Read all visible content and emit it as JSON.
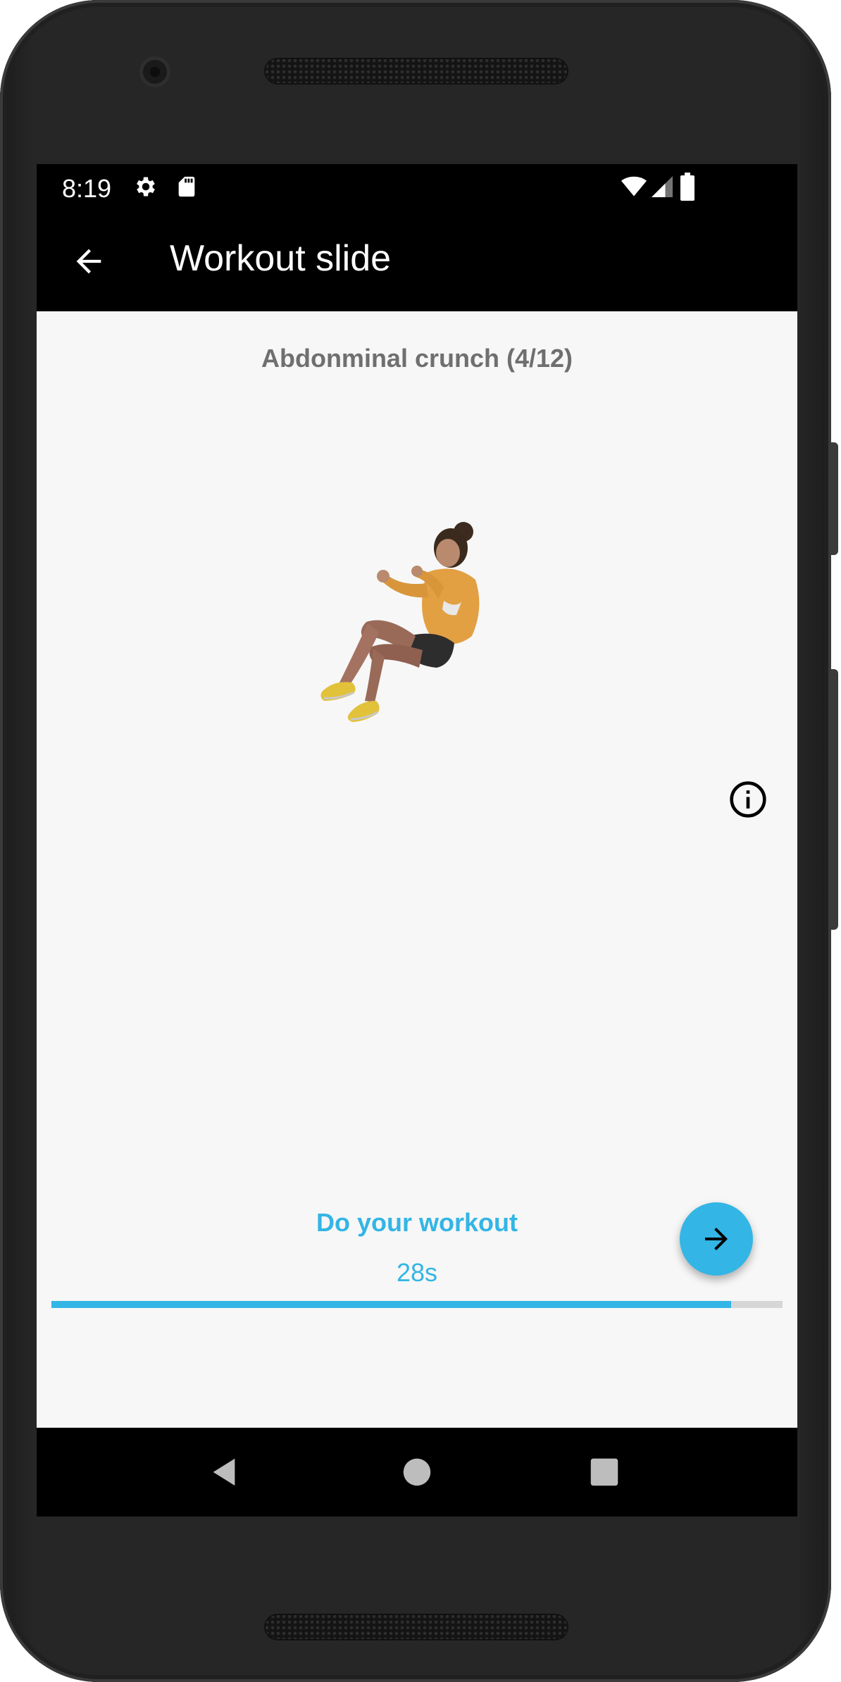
{
  "status_bar": {
    "time": "8:19",
    "left_icons": [
      "settings-icon",
      "sd-card-icon"
    ],
    "right_icons": [
      "wifi-icon",
      "cell-signal-icon",
      "battery-icon"
    ]
  },
  "app_bar": {
    "title": "Workout slide",
    "back_icon": "arrow-back-icon"
  },
  "exercise": {
    "title": "Abdonminal crunch (4/12)",
    "illustration": "person-doing-crunch"
  },
  "info_icon": "info-circle-icon",
  "workout": {
    "phase_label": "Do your workout",
    "timer_text": "28s",
    "progress_fraction": 0.93
  },
  "next_button": {
    "icon": "arrow-forward-icon"
  },
  "colors": {
    "accent": "#33b5e5",
    "title_gray": "#6f6f6f",
    "bar_black": "#000000",
    "screen_bg": "#f7f7f7"
  },
  "nav_bar": {
    "icons": [
      "back-triangle-icon",
      "home-circle-icon",
      "recents-square-icon"
    ]
  }
}
